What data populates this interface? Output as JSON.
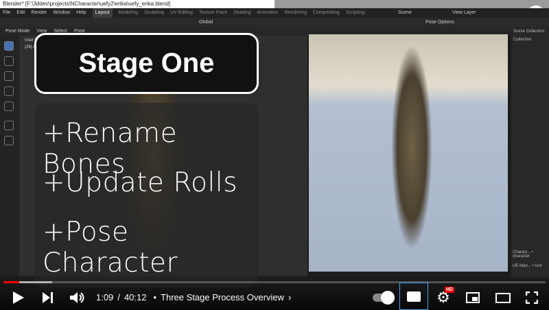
{
  "window": {
    "title": "Blender* [F:\\3ddev\\projects\\NCharacter\\uefy2\\erika\\uefy_erika.blend]"
  },
  "menu": {
    "items": [
      "File",
      "Edit",
      "Render",
      "Window",
      "Help"
    ],
    "workspaces": [
      "Layout",
      "Modeling",
      "Sculpting",
      "UV Editing",
      "Texture Paint",
      "Shading",
      "Animation",
      "Rendering",
      "Compositing",
      "Scripting"
    ]
  },
  "toolbar": {
    "orientation": "Global",
    "scene": "Scene",
    "view_layer": "View Layer",
    "pose_options": "Pose Options"
  },
  "modebar": {
    "mode": "Pose Mode",
    "items": [
      "View",
      "Select",
      "Pose"
    ]
  },
  "viewport": {
    "info1": "User Perspective",
    "info2": "(29) Armature : chest"
  },
  "outliner": {
    "scene_collection": "Scene Collection",
    "collection": "Collection",
    "items": [
      "Charact... • character",
      "UE Man... • root"
    ]
  },
  "overlay": {
    "title": "Stage One",
    "steps": [
      "+Rename Bones",
      "+Update Rolls",
      "+Pose Character"
    ]
  },
  "player": {
    "current_time": "1:09",
    "duration": "40:12",
    "separator": "/",
    "chapter": "Three Stage Process Overview",
    "played_fraction": 0.029,
    "buffered_fraction": 0.09,
    "hd_badge": "HD",
    "autoplay": true
  },
  "colors": {
    "accent": "#ff0000"
  }
}
